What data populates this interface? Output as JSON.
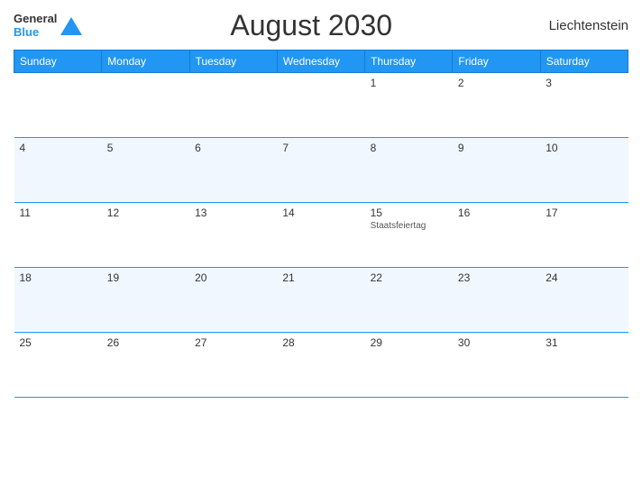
{
  "header": {
    "logo_general": "General",
    "logo_blue": "Blue",
    "title": "August 2030",
    "country": "Liechtenstein"
  },
  "weekdays": [
    "Sunday",
    "Monday",
    "Tuesday",
    "Wednesday",
    "Thursday",
    "Friday",
    "Saturday"
  ],
  "rows": [
    {
      "alt": false,
      "cells": [
        {
          "day": "",
          "holiday": ""
        },
        {
          "day": "",
          "holiday": ""
        },
        {
          "day": "",
          "holiday": ""
        },
        {
          "day": "1",
          "holiday": ""
        },
        {
          "day": "2",
          "holiday": ""
        },
        {
          "day": "3",
          "holiday": ""
        }
      ]
    },
    {
      "alt": true,
      "cells": [
        {
          "day": "4",
          "holiday": ""
        },
        {
          "day": "5",
          "holiday": ""
        },
        {
          "day": "6",
          "holiday": ""
        },
        {
          "day": "7",
          "holiday": ""
        },
        {
          "day": "8",
          "holiday": ""
        },
        {
          "day": "9",
          "holiday": ""
        },
        {
          "day": "10",
          "holiday": ""
        }
      ]
    },
    {
      "alt": false,
      "cells": [
        {
          "day": "11",
          "holiday": ""
        },
        {
          "day": "12",
          "holiday": ""
        },
        {
          "day": "13",
          "holiday": ""
        },
        {
          "day": "14",
          "holiday": ""
        },
        {
          "day": "15",
          "holiday": "Staatsfeiertag"
        },
        {
          "day": "16",
          "holiday": ""
        },
        {
          "day": "17",
          "holiday": ""
        }
      ]
    },
    {
      "alt": true,
      "cells": [
        {
          "day": "18",
          "holiday": ""
        },
        {
          "day": "19",
          "holiday": ""
        },
        {
          "day": "20",
          "holiday": ""
        },
        {
          "day": "21",
          "holiday": ""
        },
        {
          "day": "22",
          "holiday": ""
        },
        {
          "day": "23",
          "holiday": ""
        },
        {
          "day": "24",
          "holiday": ""
        }
      ]
    },
    {
      "alt": false,
      "cells": [
        {
          "day": "25",
          "holiday": ""
        },
        {
          "day": "26",
          "holiday": ""
        },
        {
          "day": "27",
          "holiday": ""
        },
        {
          "day": "28",
          "holiday": ""
        },
        {
          "day": "29",
          "holiday": ""
        },
        {
          "day": "30",
          "holiday": ""
        },
        {
          "day": "31",
          "holiday": ""
        }
      ]
    }
  ]
}
